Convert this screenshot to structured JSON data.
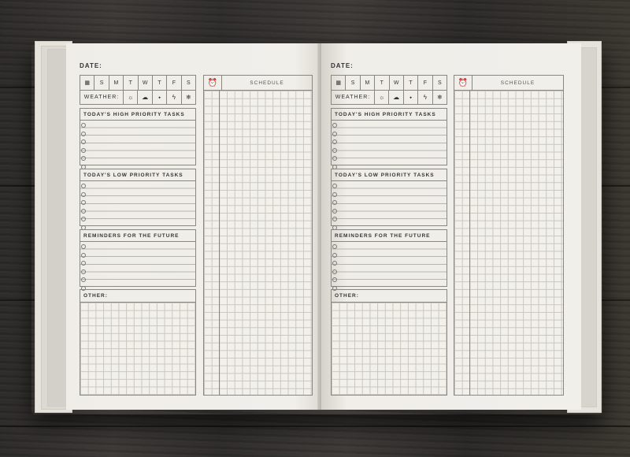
{
  "left_page": {
    "date_label": "DATE:",
    "days": [
      "S",
      "M",
      "T",
      "W",
      "T",
      "F",
      "S"
    ],
    "calendar_icon": "▦",
    "weather_label": "WEATHER:",
    "weather_icons": [
      "☼",
      "☁",
      "⬩",
      "ϟ",
      "❄"
    ],
    "high_priority": "TODAY'S HIGH PRIORITY TASKS",
    "low_priority": "TODAY'S LOW PRIORITY TASKS",
    "reminders": "REMINDERS FOR THE FUTURE",
    "other": "OTHER:",
    "schedule_icon": "⏰",
    "schedule": "SCHEDULE"
  },
  "right_page": {
    "date_label": "DATE:",
    "days": [
      "S",
      "M",
      "T",
      "W",
      "T",
      "F",
      "S"
    ],
    "calendar_icon": "▦",
    "weather_label": "WEATHER:",
    "weather_icons": [
      "☼",
      "☁",
      "⬩",
      "ϟ",
      "❄"
    ],
    "high_priority": "TODAY'S HIGH PRIORITY TASKS",
    "low_priority": "TODAY'S LOW PRIORITY TASKS",
    "reminders": "REMINDERS FOR THE FUTURE",
    "other": "OTHER:",
    "schedule_icon": "⏰",
    "schedule": "SCHEDULE"
  },
  "colors": {
    "wood": "#2f2d2a",
    "paper": "#f0eee9",
    "ink": "#333333"
  }
}
